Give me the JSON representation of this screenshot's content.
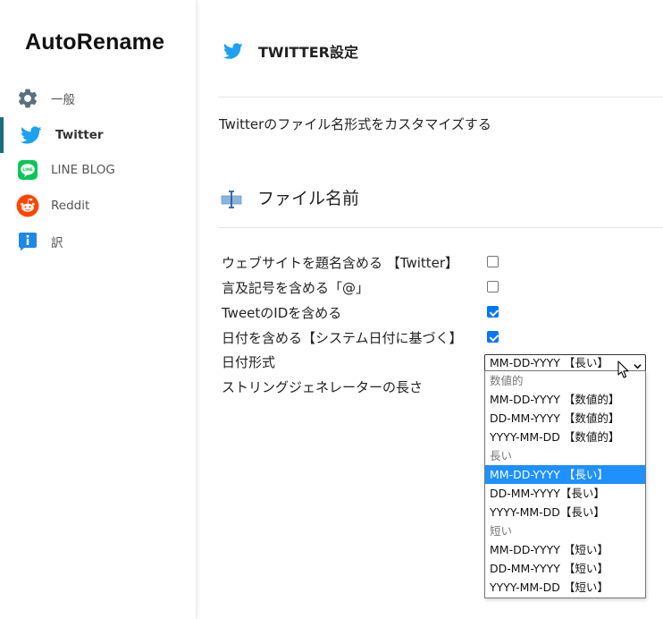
{
  "app": {
    "title": "AutoRename"
  },
  "sidebar": {
    "items": [
      {
        "label": "一般",
        "icon": "gear-icon"
      },
      {
        "label": "Twitter",
        "icon": "twitter-icon",
        "active": true
      },
      {
        "label": "LINE BLOG",
        "icon": "line-icon"
      },
      {
        "label": "Reddit",
        "icon": "reddit-icon"
      },
      {
        "label": "訳",
        "icon": "info-icon"
      }
    ]
  },
  "header": {
    "title": "TWITTER設定",
    "icon": "twitter-icon"
  },
  "description": "Twitterのファイル名形式をカスタマイズする",
  "section": {
    "title": "ファイル名前",
    "icon": "text-cursor-icon"
  },
  "options": [
    {
      "label": "ウェブサイトを題名含める 【Twitter】",
      "checked": false
    },
    {
      "label": "言及記号を含める「@」",
      "checked": false
    },
    {
      "label": "TweetのIDを含める",
      "checked": true
    },
    {
      "label": "日付を含める【システム日付に基づく】",
      "checked": true
    }
  ],
  "date_format": {
    "label": "日付形式",
    "selected": "MM-DD-YYYY 【長い】",
    "groups": [
      {
        "group": "数値的",
        "options": [
          "MM-DD-YYYY 【数値的】",
          "DD-MM-YYYY 【数値的】",
          "YYYY-MM-DD 【数値的】"
        ]
      },
      {
        "group": "長い",
        "options": [
          "MM-DD-YYYY 【長い】",
          "DD-MM-YYYY【長い】",
          "YYYY-MM-DD【長い】"
        ]
      },
      {
        "group": "短い",
        "options": [
          "MM-DD-YYYY 【短い】",
          "DD-MM-YYYY 【短い】",
          "YYYY-MM-DD 【短い】"
        ]
      }
    ]
  },
  "string_generator": {
    "label": "ストリングジェネレーターの長さ"
  },
  "colors": {
    "accent": "#1d6e7a",
    "twitter": "#1da1f2",
    "checkbox": "#0075ff",
    "selected_option": "#1e90ff",
    "line": "#06c755",
    "reddit": "#ff4500",
    "info": "#1e88e5",
    "gear": "#5a6f7d"
  }
}
